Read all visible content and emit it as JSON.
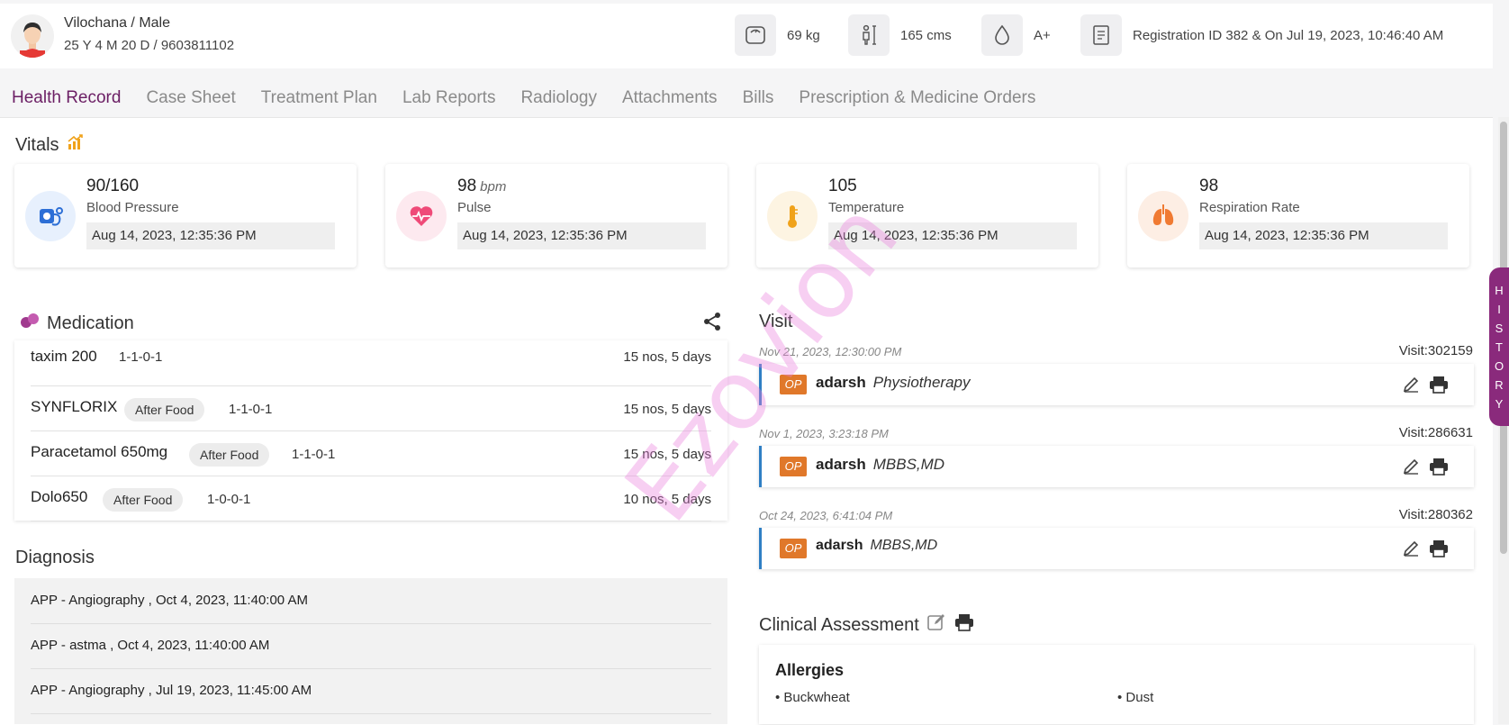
{
  "patient": {
    "name_gender": "Vilochana / Male",
    "age_phone": "25 Y 4 M 20 D / 9603811102",
    "weight": "69 kg",
    "height": "165 cms",
    "blood_group": "A+",
    "registration": "Registration ID 382 & On Jul 19, 2023, 10:46:40 AM"
  },
  "tabs": [
    {
      "label": "Health Record",
      "active": true
    },
    {
      "label": "Case Sheet"
    },
    {
      "label": "Treatment Plan"
    },
    {
      "label": "Lab Reports"
    },
    {
      "label": "Radiology"
    },
    {
      "label": "Attachments"
    },
    {
      "label": "Bills"
    },
    {
      "label": "Prescription & Medicine Orders"
    }
  ],
  "vitals": {
    "title": "Vitals",
    "cards": [
      {
        "value": "90/160",
        "unit": "",
        "label": "Blood Pressure",
        "timestamp": "Aug 14, 2023, 12:35:36 PM",
        "icon": "blood-pressure-icon",
        "color": "#2d6fd6"
      },
      {
        "value": "98",
        "unit": "bpm",
        "label": "Pulse",
        "timestamp": "Aug 14, 2023, 12:35:36 PM",
        "icon": "heart-pulse-icon",
        "color": "#ef4a78"
      },
      {
        "value": "105",
        "unit": "",
        "label": "Temperature",
        "timestamp": "Aug 14, 2023, 12:35:36 PM",
        "icon": "thermometer-icon",
        "color": "#f0a21a"
      },
      {
        "value": "98",
        "unit": "",
        "label": "Respiration Rate",
        "timestamp": "Aug 14, 2023, 12:35:36 PM",
        "icon": "lungs-icon",
        "color": "#f07a32"
      }
    ]
  },
  "medication": {
    "title": "Medication",
    "items": [
      {
        "name": "taxim 200",
        "chip": "",
        "dose": "1-1-0-1",
        "qty": "15 nos, 5 days"
      },
      {
        "name": "SYNFLORIX",
        "chip": "After Food",
        "dose": "1-1-0-1",
        "qty": "15 nos, 5 days"
      },
      {
        "name": "Paracetamol 650mg",
        "chip": "After Food",
        "dose": "1-1-0-1",
        "qty": "15 nos, 5 days"
      },
      {
        "name": "Dolo650",
        "chip": "After Food",
        "dose": "1-0-0-1",
        "qty": "10 nos, 5 days"
      }
    ]
  },
  "diagnosis": {
    "title": "Diagnosis",
    "items": [
      "APP - Angiography , Oct 4, 2023, 11:40:00 AM",
      "APP - astma , Oct 4, 2023, 11:40:00 AM",
      "APP - Angiography , Jul 19, 2023, 11:45:00 AM"
    ]
  },
  "visit": {
    "title": "Visit",
    "items": [
      {
        "date": "Nov 21, 2023, 12:30:00 PM",
        "id": "Visit:302159",
        "type": "OP",
        "doctor": "adarsh",
        "specialty": "Physiotherapy"
      },
      {
        "date": "Nov 1, 2023, 3:23:18 PM",
        "id": "Visit:286631",
        "type": "OP",
        "doctor": "adarsh",
        "specialty": "MBBS,MD"
      },
      {
        "date": "Oct 24, 2023, 6:41:04 PM",
        "id": "Visit:280362",
        "type": "OP",
        "doctor": "adarsh",
        "specialty": "MBBS,MD"
      }
    ]
  },
  "clinical": {
    "title": "Clinical Assessment",
    "allergies_title": "Allergies",
    "allergies": [
      "Buckwheat",
      "Dust"
    ]
  },
  "history_tab": [
    "H",
    "I",
    "S",
    "T",
    "O",
    "R",
    "Y"
  ],
  "watermark": "Ezovion"
}
